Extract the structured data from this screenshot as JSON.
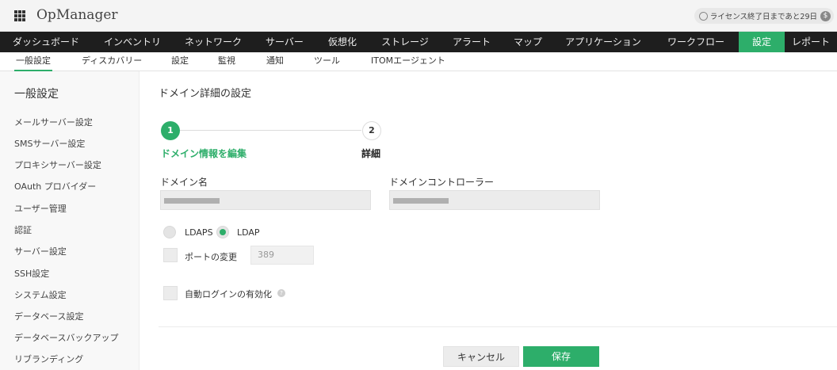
{
  "app": {
    "brand": "OpManager",
    "license_text": "ライセンス終了日まであと29日",
    "license_icon": "clock-icon",
    "coin_symbol": "$",
    "menu_icon": "grid-menu-icon"
  },
  "main_nav": [
    {
      "label": "ダッシュボード",
      "active": false
    },
    {
      "label": "インベントリ",
      "active": false
    },
    {
      "label": "ネットワーク",
      "active": false
    },
    {
      "label": "サーバー",
      "active": false
    },
    {
      "label": "仮想化",
      "active": false
    },
    {
      "label": "ストレージ",
      "active": false
    },
    {
      "label": "アラート",
      "active": false
    },
    {
      "label": "マップ",
      "active": false
    },
    {
      "label": "アプリケーション",
      "active": false
    },
    {
      "label": "ワークフロー",
      "active": false
    },
    {
      "label": "設定",
      "active": true
    },
    {
      "label": "レポート",
      "active": false
    }
  ],
  "sub_nav": [
    {
      "label": "一般設定",
      "active": true
    },
    {
      "label": "ディスカバリー",
      "active": false
    },
    {
      "label": "設定",
      "active": false
    },
    {
      "label": "監視",
      "active": false
    },
    {
      "label": "通知",
      "active": false
    },
    {
      "label": "ツール",
      "active": false
    },
    {
      "label": "ITOMエージェント",
      "active": false
    }
  ],
  "sidebar": {
    "title": "一般設定",
    "items": [
      "メールサーバー設定",
      "SMSサーバー設定",
      "プロキシサーバー設定",
      "OAuth プロバイダー",
      "ユーザー管理",
      "認証",
      "サーバー設定",
      "SSH設定",
      "システム設定",
      "データベース設定",
      "データベースバックアップ",
      "リブランディング"
    ]
  },
  "content": {
    "title": "ドメイン詳細の設定",
    "steps": [
      {
        "number": "1",
        "label": "ドメイン情報を編集",
        "active": true
      },
      {
        "number": "2",
        "label": "詳細",
        "active": false
      }
    ],
    "domain_name_label": "ドメイン名",
    "domain_controller_label": "ドメインコントローラー",
    "protocol": {
      "options": [
        "LDAPS",
        "LDAP"
      ],
      "selected": "LDAP"
    },
    "port_change_label": "ポートの変更",
    "port_placeholder": "389",
    "auto_login_label": "自動ログインの有効化",
    "help_symbol": "?",
    "buttons": {
      "cancel": "キャンセル",
      "save": "保存"
    },
    "colors": {
      "accent": "#2dae6a",
      "nav_bg": "#1e1e1e"
    }
  }
}
